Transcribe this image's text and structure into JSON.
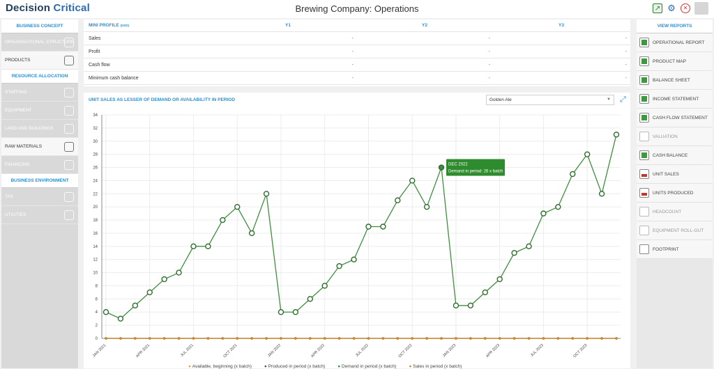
{
  "header": {
    "logo_main": "Decision",
    "logo_accent": "Critical",
    "title": "Brewing Company: Operations"
  },
  "left_sidebar": {
    "sections": [
      {
        "label": "BUSINESS CONCEPT",
        "items": [
          {
            "label": "ORGANISATIONAL STRUCTURE",
            "active": false
          },
          {
            "label": "PRODUCTS",
            "active": true
          }
        ]
      },
      {
        "label": "RESOURCE ALLOCATION",
        "items": [
          {
            "label": "STAFFING",
            "active": false
          },
          {
            "label": "EQUIPMENT",
            "active": false
          },
          {
            "label": "LAND AND BUILDINGS",
            "active": false
          },
          {
            "label": "RAW MATERIALS",
            "active": true
          },
          {
            "label": "FINANCING",
            "active": false
          }
        ]
      },
      {
        "label": "BUSINESS ENVIRONMENT",
        "items": [
          {
            "label": "TAX",
            "active": false
          },
          {
            "label": "UTILITIES",
            "active": false
          }
        ]
      }
    ]
  },
  "right_sidebar": {
    "heading": "VIEW REPORTS",
    "items": [
      {
        "label": "OPERATIONAL REPORT",
        "icon": "operational-report-icon",
        "dim": false
      },
      {
        "label": "PRODUCT MAP",
        "icon": "product-map-icon",
        "dim": false
      },
      {
        "label": "BALANCE SHEET",
        "icon": "balance-sheet-icon",
        "dim": false
      },
      {
        "label": "INCOME STATEMENT",
        "icon": "income-statement-icon",
        "dim": false
      },
      {
        "label": "CASH FLOW STATEMENT",
        "icon": "cash-flow-icon",
        "dim": false
      },
      {
        "label": "VALUATION",
        "icon": "valuation-icon",
        "dim": true
      },
      {
        "label": "CASH BALANCE",
        "icon": "cash-balance-icon",
        "dim": false
      },
      {
        "label": "UNIT SALES",
        "icon": "unit-sales-icon",
        "dim": false
      },
      {
        "label": "UNITS PRODUCED",
        "icon": "units-produced-icon",
        "dim": false
      },
      {
        "label": "HEADCOUNT",
        "icon": "headcount-icon",
        "dim": true
      },
      {
        "label": "EQUIPMENT ROLL-OUT",
        "icon": "equipment-rollout-icon",
        "dim": true
      },
      {
        "label": "FOOTPRINT",
        "icon": "footprint-icon",
        "dim": false
      }
    ]
  },
  "mini_profile": {
    "title": "MINI PROFILE",
    "unit": "(USD)",
    "columns": [
      "Y1",
      "Y2",
      "Y3"
    ],
    "rows": [
      {
        "label": "Sales",
        "values": [
          "-",
          "-",
          "-"
        ]
      },
      {
        "label": "Profit",
        "values": [
          "-",
          "-",
          "-"
        ]
      },
      {
        "label": "Cash flow",
        "values": [
          "-",
          "-",
          "-"
        ]
      },
      {
        "label": "Minimum cash balance",
        "values": [
          "-",
          "-",
          "-"
        ]
      }
    ]
  },
  "chart_panel": {
    "title": "UNIT SALES AS LESSER OF DEMAND OR AVAILABILITY IN PERIOD",
    "selected_product": "Golden Ale",
    "tooltip": {
      "line1": "DEC 2022",
      "line2": "Demand in period: 26 x batch"
    }
  },
  "chart_data": {
    "type": "line",
    "ylim": [
      0,
      34
    ],
    "yticks": [
      0,
      2,
      4,
      6,
      8,
      10,
      12,
      14,
      16,
      18,
      20,
      22,
      24,
      26,
      28,
      30,
      32,
      34
    ],
    "x_tick_labels": [
      "JAN 2021",
      "APR 2021",
      "JUL 2021",
      "OCT 2021",
      "JAN 2022",
      "APR 2022",
      "JUL 2022",
      "OCT 2022",
      "JAN 2023",
      "APR 2023",
      "JUL 2023",
      "OCT 2023"
    ],
    "x": [
      "JAN 2021",
      "FEB 2021",
      "MAR 2021",
      "APR 2021",
      "MAY 2021",
      "JUN 2021",
      "JUL 2021",
      "AUG 2021",
      "SEP 2021",
      "OCT 2021",
      "NOV 2021",
      "DEC 2021",
      "JAN 2022",
      "FEB 2022",
      "MAR 2022",
      "APR 2022",
      "MAY 2022",
      "JUN 2022",
      "JUL 2022",
      "AUG 2022",
      "SEP 2022",
      "OCT 2022",
      "NOV 2022",
      "DEC 2022",
      "JAN 2023",
      "FEB 2023",
      "MAR 2023",
      "APR 2023",
      "MAY 2023",
      "JUN 2023",
      "JUL 2023",
      "AUG 2023",
      "SEP 2023",
      "OCT 2023",
      "NOV 2023",
      "DEC 2023"
    ],
    "series": [
      {
        "name": "Available, beginning (x batch)",
        "color": "#e8a33d",
        "values": [
          0,
          0,
          0,
          0,
          0,
          0,
          0,
          0,
          0,
          0,
          0,
          0,
          0,
          0,
          0,
          0,
          0,
          0,
          0,
          0,
          0,
          0,
          0,
          0,
          0,
          0,
          0,
          0,
          0,
          0,
          0,
          0,
          0,
          0,
          0,
          0
        ]
      },
      {
        "name": "Produced in period (x batch)",
        "color": "#5b4a9e",
        "values": [
          0,
          0,
          0,
          0,
          0,
          0,
          0,
          0,
          0,
          0,
          0,
          0,
          0,
          0,
          0,
          0,
          0,
          0,
          0,
          0,
          0,
          0,
          0,
          0,
          0,
          0,
          0,
          0,
          0,
          0,
          0,
          0,
          0,
          0,
          0,
          0
        ]
      },
      {
        "name": "Demand in period (x batch)",
        "color": "#3e8e3e",
        "values": [
          4,
          3,
          5,
          7,
          9,
          10,
          14,
          14,
          18,
          20,
          16,
          22,
          4,
          4,
          6,
          8,
          11,
          12,
          17,
          17,
          21,
          24,
          20,
          26,
          5,
          5,
          7,
          9,
          13,
          14,
          19,
          20,
          25,
          28,
          22,
          31
        ]
      },
      {
        "name": "Sales in period (x batch)",
        "color": "#c98b2a",
        "values": [
          0,
          0,
          0,
          0,
          0,
          0,
          0,
          0,
          0,
          0,
          0,
          0,
          0,
          0,
          0,
          0,
          0,
          0,
          0,
          0,
          0,
          0,
          0,
          0,
          0,
          0,
          0,
          0,
          0,
          0,
          0,
          0,
          0,
          0,
          0,
          0
        ]
      }
    ],
    "highlight_index": 23,
    "grid": true
  }
}
